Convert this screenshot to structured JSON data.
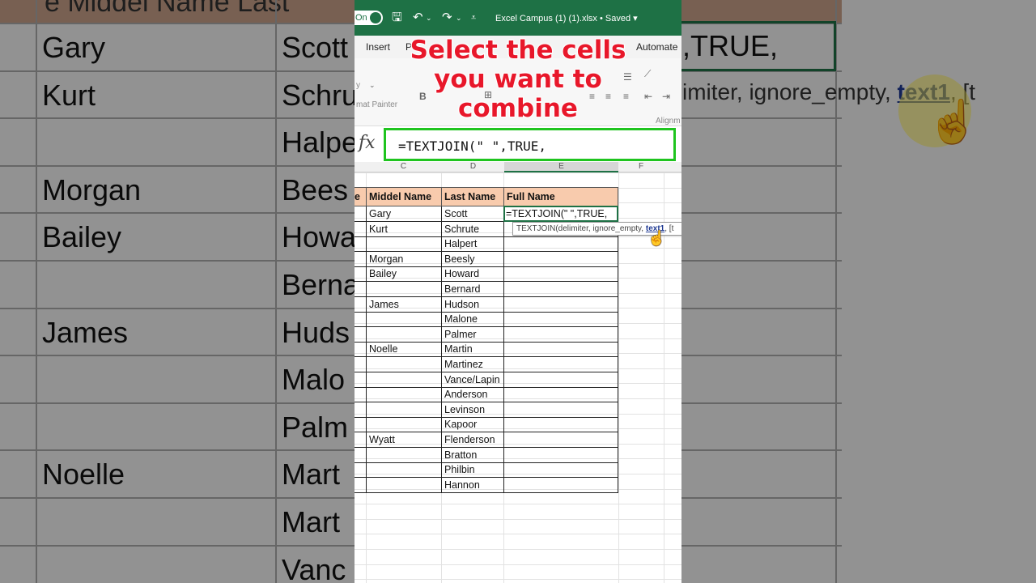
{
  "window": {
    "autosave_label": "On",
    "title": "Excel Campus (1) (1).xlsx • Saved ▾"
  },
  "ribbon": {
    "tabs": [
      "Insert",
      "P",
      "Automate"
    ],
    "clipboard_hint": "y",
    "format_painter": "mat Painter",
    "bold": "B",
    "group_label": "Alignm"
  },
  "overlay": {
    "caption_line1": "Select the cells",
    "caption_line2": "you want to",
    "caption_line3": "combine"
  },
  "formula_bar": {
    "fx_label": "fx",
    "value": "=TEXTJOIN(\" \",TRUE,"
  },
  "columns": {
    "c": "C",
    "d": "D",
    "e": "E",
    "f": "F"
  },
  "table": {
    "headers": {
      "first_partial": "e",
      "middle": "Middel Name",
      "last": "Last Name",
      "full": "Full Name"
    },
    "active_cell_text": "=TEXTJOIN(\" \",TRUE,",
    "rows": [
      {
        "middle": "Gary",
        "last": "Scott"
      },
      {
        "middle": "Kurt",
        "last": "Schrute"
      },
      {
        "middle": "",
        "last": "Halpert"
      },
      {
        "middle": "Morgan",
        "last": "Beesly"
      },
      {
        "middle": "Bailey",
        "last": "Howard"
      },
      {
        "middle": "",
        "last": "Bernard"
      },
      {
        "middle": "James",
        "last": "Hudson"
      },
      {
        "middle": "",
        "last": "Malone"
      },
      {
        "middle": "",
        "last": "Palmer"
      },
      {
        "middle": "Noelle",
        "last": "Martin"
      },
      {
        "middle": "",
        "last": "Martinez"
      },
      {
        "middle": "",
        "last": "Vance/Lapin"
      },
      {
        "middle": "",
        "last": "Anderson"
      },
      {
        "middle": "",
        "last": "Levinson"
      },
      {
        "middle": "",
        "last": "Kapoor"
      },
      {
        "middle": "Wyatt",
        "last": "Flenderson"
      },
      {
        "middle": "",
        "last": "Bratton"
      },
      {
        "middle": "",
        "last": "Philbin"
      },
      {
        "middle": "",
        "last": "Hannon"
      }
    ]
  },
  "tooltip": {
    "prefix": "TEXTJOIN(delimiter, ignore_empty, ",
    "highlight": "text1",
    "suffix": ", [t"
  },
  "background_zoom": {
    "header_text": "e Middel Name   Last",
    "formula_text": ",TRUE,",
    "tip_prefix": "imiter, ignore_empty, ",
    "tip_highlight": "text1",
    "tip_suffix": ", [t",
    "middle_names": [
      "Gary",
      "Kurt",
      "",
      "Morgan",
      "Bailey",
      "",
      "James",
      "",
      "",
      "Noelle",
      "",
      ""
    ],
    "last_names": [
      "Scott",
      "Schru",
      "Halpe",
      "Bees",
      "Howa",
      "Berna",
      "Huds",
      "Malo",
      "Palm",
      "Mart",
      "Mart",
      "Vanc"
    ]
  },
  "colors": {
    "excel_green": "#1e7145",
    "header_fill": "#f8cbad",
    "caption_red": "#e8172a",
    "formula_border": "#1fc41f"
  }
}
